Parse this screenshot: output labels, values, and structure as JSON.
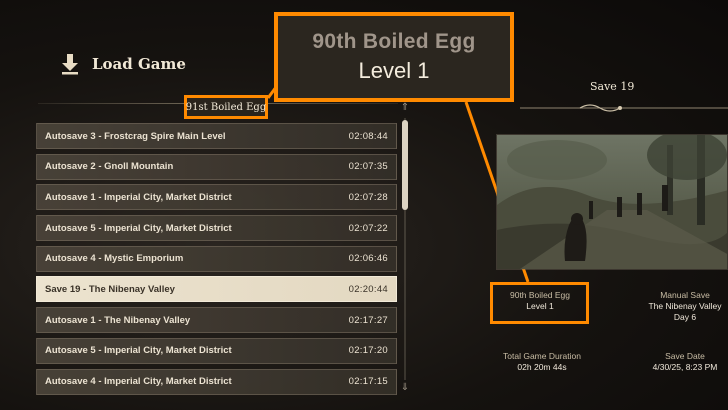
{
  "header": {
    "title": "Load Game",
    "icon": "download-arrow-icon"
  },
  "profile_tag": "91st Boiled Egg",
  "callout": {
    "name": "90th Boiled Egg",
    "level": "Level 1"
  },
  "saves": [
    {
      "name": "Autosave 3 - Frostcrag Spire Main Level",
      "time": "02:08:44"
    },
    {
      "name": "Autosave 2 - Gnoll Mountain",
      "time": "02:07:35"
    },
    {
      "name": "Autosave 1 - Imperial City, Market District",
      "time": "02:07:28"
    },
    {
      "name": "Autosave 5 - Imperial City, Market District",
      "time": "02:07:22"
    },
    {
      "name": "Autosave 4 - Mystic Emporium",
      "time": "02:06:46"
    },
    {
      "name": "Save 19 - The Nibenay Valley",
      "time": "02:20:44",
      "selected": true
    },
    {
      "name": "Autosave 1 - The Nibenay Valley",
      "time": "02:17:27"
    },
    {
      "name": "Autosave 5 - Imperial City, Market District",
      "time": "02:17:20"
    },
    {
      "name": "Autosave 4 - Imperial City, Market District",
      "time": "02:17:15"
    }
  ],
  "detail": {
    "title": "Save 19",
    "character_name": "90th Boiled Egg",
    "character_level": "Level 1",
    "save_type_label": "Manual Save",
    "location": "The Nibenay Valley",
    "day": "Day 6",
    "duration_label": "Total Game Duration",
    "duration_value": "02h 20m 44s",
    "date_label": "Save Date",
    "date_value": "4/30/25, 8:23 PM"
  },
  "colors": {
    "accent": "#ff8a00",
    "selected_row": "#ece3cf",
    "row": "#4b443a"
  }
}
